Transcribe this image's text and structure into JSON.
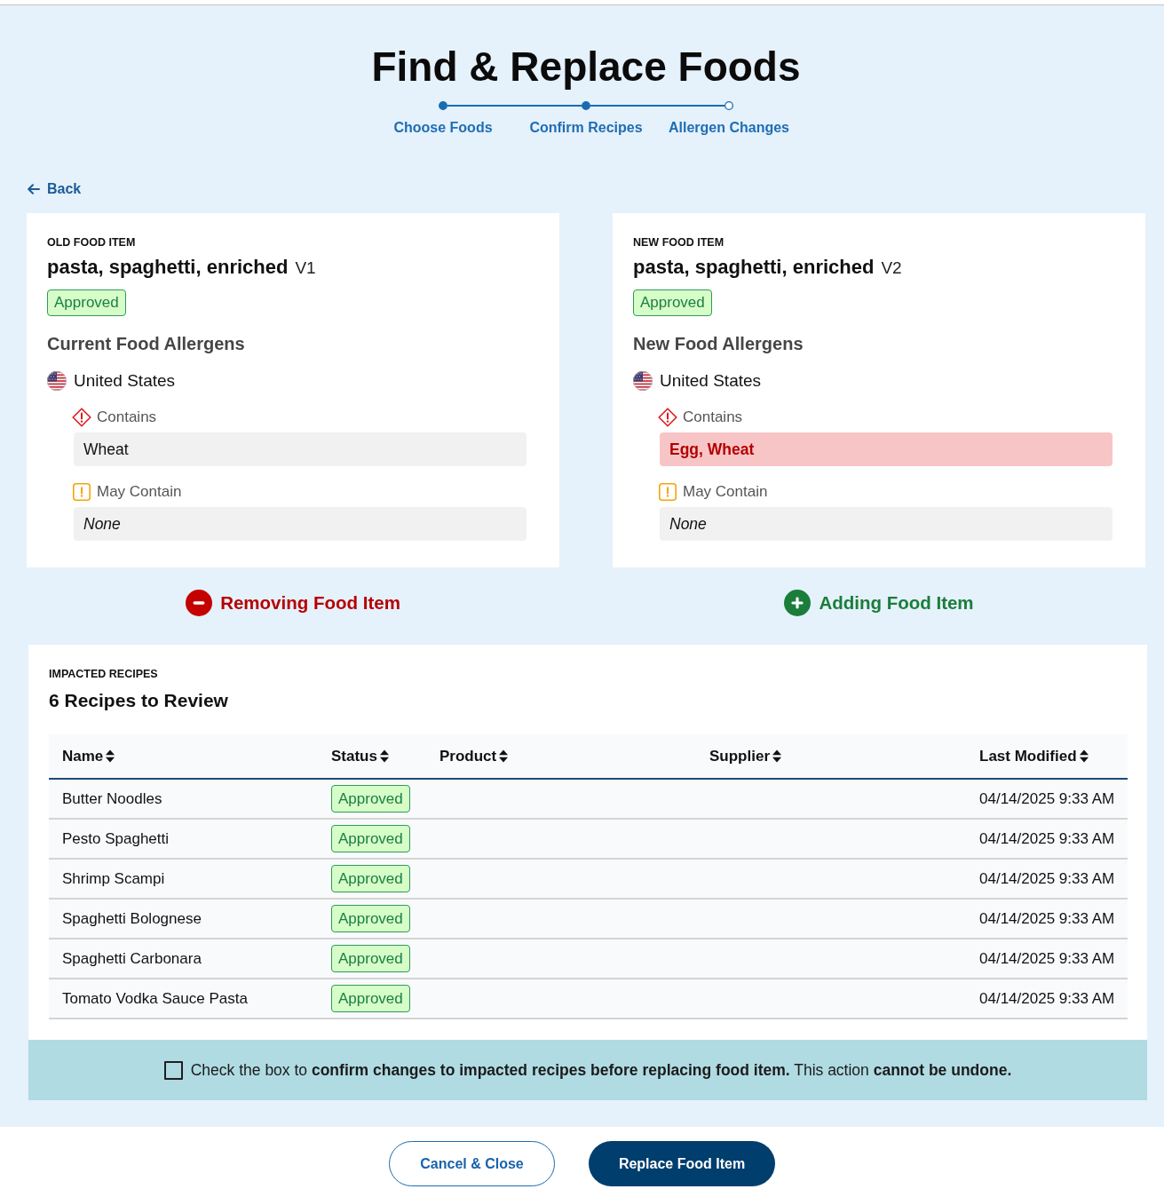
{
  "page": {
    "title": "Find & Replace Foods"
  },
  "steps": [
    {
      "label": "Choose Foods",
      "completed": true
    },
    {
      "label": "Confirm Recipes",
      "completed": true
    },
    {
      "label": "Allergen Changes",
      "completed": false
    }
  ],
  "back_link": {
    "label": "Back"
  },
  "food_items": [
    {
      "eyebrow": "OLD FOOD ITEM",
      "name": "pasta, spaghetti, enriched",
      "version": "V1",
      "status": "Approved",
      "allergens_title": "Current Food Allergens",
      "region": "United States",
      "allergen_groups": [
        {
          "kind": "contains",
          "label": "Contains",
          "value": "Wheat",
          "changed": false,
          "empty": false
        },
        {
          "kind": "may_contain",
          "label": "May Contain",
          "value": "None",
          "changed": false,
          "empty": true
        }
      ],
      "action": {
        "kind": "remove",
        "label": "Removing Food Item"
      }
    },
    {
      "eyebrow": "NEW FOOD ITEM",
      "name": "pasta, spaghetti, enriched",
      "version": "V2",
      "status": "Approved",
      "allergens_title": "New Food Allergens",
      "region": "United States",
      "allergen_groups": [
        {
          "kind": "contains",
          "label": "Contains",
          "value": "Egg, Wheat",
          "changed": true,
          "empty": false
        },
        {
          "kind": "may_contain",
          "label": "May Contain",
          "value": "None",
          "changed": false,
          "empty": true
        }
      ],
      "action": {
        "kind": "add",
        "label": "Adding Food Item"
      }
    }
  ],
  "impacted_recipes": {
    "eyebrow": "IMPACTED RECIPES",
    "title": "6 Recipes to Review",
    "columns": [
      "Name",
      "Status",
      "Product",
      "Supplier",
      "Last Modified"
    ],
    "rows": [
      {
        "name": "Butter Noodles",
        "status": "Approved",
        "last_modified": "04/14/2025 9:33 AM"
      },
      {
        "name": "Pesto Spaghetti",
        "status": "Approved",
        "last_modified": "04/14/2025 9:33 AM"
      },
      {
        "name": "Shrimp Scampi",
        "status": "Approved",
        "last_modified": "04/14/2025 9:33 AM"
      },
      {
        "name": "Spaghetti Bolognese",
        "status": "Approved",
        "last_modified": "04/14/2025 9:33 AM"
      },
      {
        "name": "Spaghetti Carbonara",
        "status": "Approved",
        "last_modified": "04/14/2025 9:33 AM"
      },
      {
        "name": "Tomato Vodka Sauce Pasta",
        "status": "Approved",
        "last_modified": "04/14/2025 9:33 AM"
      }
    ]
  },
  "confirmation": {
    "checked": false,
    "text": "Check the box to **confirm changes to impacted recipes before replacing food item.** This action **cannot be undone.**"
  },
  "buttons": [
    {
      "label": "Cancel & Close",
      "kind": "secondary"
    },
    {
      "label": "Replace Food Item",
      "kind": "primary"
    }
  ]
}
